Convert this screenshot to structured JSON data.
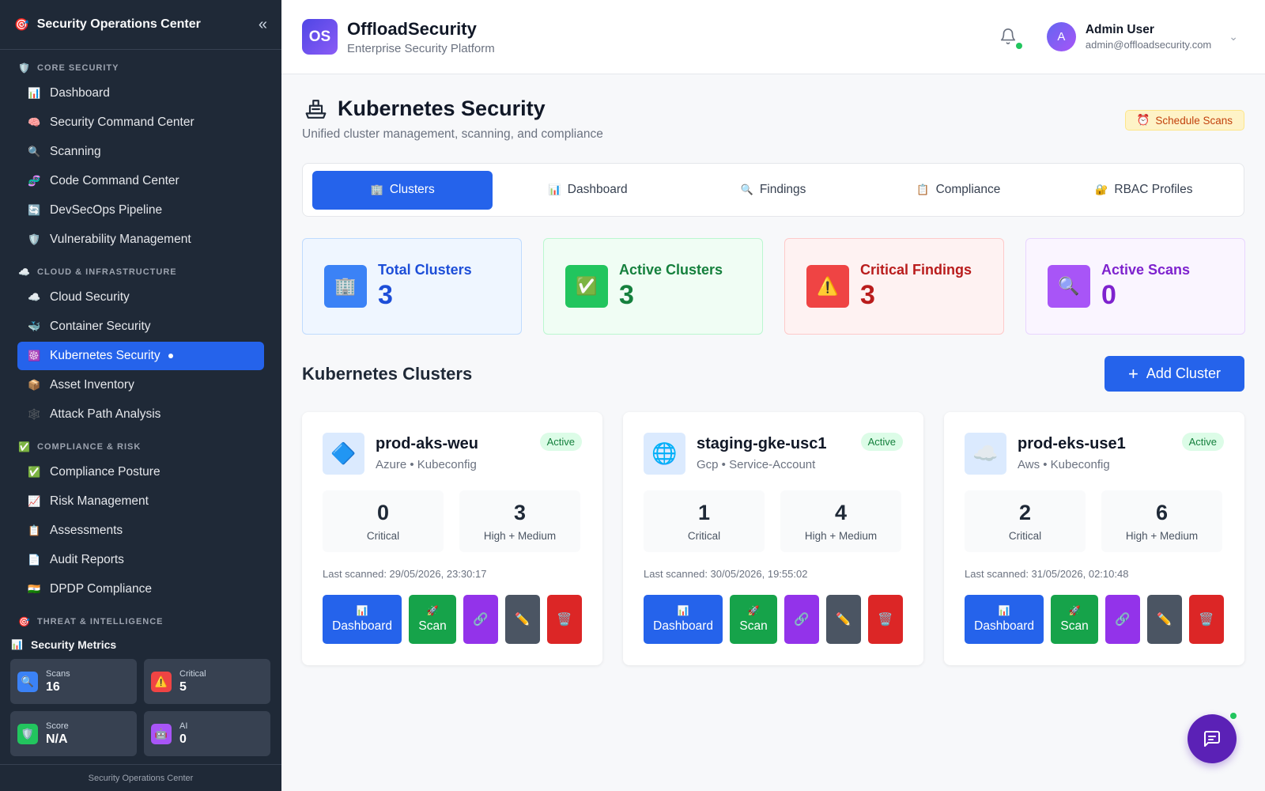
{
  "sidebar": {
    "title": "Security Operations Center",
    "sections": [
      {
        "label": "CORE SECURITY",
        "icon": "🛡️",
        "items": [
          {
            "label": "Dashboard",
            "icon": "📊"
          },
          {
            "label": "Security Command Center",
            "icon": "🧠"
          },
          {
            "label": "Scanning",
            "icon": "🔍"
          },
          {
            "label": "Code Command Center",
            "icon": "🧬"
          },
          {
            "label": "DevSecOps Pipeline",
            "icon": "🔄"
          },
          {
            "label": "Vulnerability Management",
            "icon": "🛡️"
          }
        ]
      },
      {
        "label": "CLOUD & INFRASTRUCTURE",
        "icon": "☁️",
        "items": [
          {
            "label": "Cloud Security",
            "icon": "☁️"
          },
          {
            "label": "Container Security",
            "icon": "🐳"
          },
          {
            "label": "Kubernetes Security",
            "icon": "☸️"
          },
          {
            "label": "Asset Inventory",
            "icon": "📦"
          },
          {
            "label": "Attack Path Analysis",
            "icon": "🕸️"
          }
        ]
      },
      {
        "label": "COMPLIANCE & RISK",
        "icon": "✅",
        "items": [
          {
            "label": "Compliance Posture",
            "icon": "✅"
          },
          {
            "label": "Risk Management",
            "icon": "📈"
          },
          {
            "label": "Assessments",
            "icon": "📋"
          },
          {
            "label": "Audit Reports",
            "icon": "📄"
          },
          {
            "label": "DPDP Compliance",
            "icon": "🇮🇳"
          }
        ]
      },
      {
        "label": "THREAT & INTELLIGENCE",
        "icon": "🎯",
        "items": []
      }
    ],
    "metrics_title": "Security Metrics",
    "metrics": [
      {
        "label": "Scans",
        "value": "16",
        "color": "#3b82f6",
        "icon": "🔍"
      },
      {
        "label": "Critical",
        "value": "5",
        "color": "#ef4444",
        "icon": "⚠️"
      },
      {
        "label": "Score",
        "value": "N/A",
        "color": "#22c55e",
        "icon": "🛡️"
      },
      {
        "label": "AI",
        "value": "0",
        "color": "#a855f7",
        "icon": "🤖"
      }
    ],
    "footer": "Security Operations Center"
  },
  "topbar": {
    "logo_text": "OS",
    "brand_name": "OffloadSecurity",
    "brand_sub": "Enterprise Security Platform",
    "user_initial": "A",
    "user_name": "Admin User",
    "user_email": "admin@offloadsecurity.com"
  },
  "page": {
    "title": "Kubernetes Security",
    "subtitle": "Unified cluster management, scanning, and compliance",
    "schedule_label": "Schedule Scans"
  },
  "tabs": [
    {
      "label": "Clusters",
      "icon": "🏢"
    },
    {
      "label": "Dashboard",
      "icon": "📊"
    },
    {
      "label": "Findings",
      "icon": "🔍"
    },
    {
      "label": "Compliance",
      "icon": "📋"
    },
    {
      "label": "RBAC Profiles",
      "icon": "🔐"
    }
  ],
  "stats": [
    {
      "label": "Total Clusters",
      "value": "3",
      "icon": "🏢",
      "theme": "blue"
    },
    {
      "label": "Active Clusters",
      "value": "3",
      "icon": "✅",
      "theme": "green"
    },
    {
      "label": "Critical Findings",
      "value": "3",
      "icon": "⚠️",
      "theme": "red"
    },
    {
      "label": "Active Scans",
      "value": "0",
      "icon": "🔍",
      "theme": "purple"
    }
  ],
  "clusters_section": {
    "title": "Kubernetes Clusters",
    "add_label": "Add Cluster"
  },
  "clusters": [
    {
      "name": "prod-aks-weu",
      "meta": "Azure • Kubeconfig",
      "status": "Active",
      "icon": "🔷",
      "critical": "0",
      "critical_label": "Critical",
      "high_medium": "3",
      "high_medium_label": "High + Medium",
      "last_scanned": "Last scanned: 29/05/2026, 23:30:17"
    },
    {
      "name": "staging-gke-usc1",
      "meta": "Gcp • Service-Account",
      "status": "Active",
      "icon": "🌐",
      "critical": "1",
      "critical_label": "Critical",
      "high_medium": "4",
      "high_medium_label": "High + Medium",
      "last_scanned": "Last scanned: 30/05/2026, 19:55:02"
    },
    {
      "name": "prod-eks-use1",
      "meta": "Aws • Kubeconfig",
      "status": "Active",
      "icon": "☁️",
      "critical": "2",
      "critical_label": "Critical",
      "high_medium": "6",
      "high_medium_label": "High + Medium",
      "last_scanned": "Last scanned: 31/05/2026, 02:10:48"
    }
  ],
  "cluster_actions": {
    "dashboard": "Dashboard",
    "scan": "Scan"
  }
}
